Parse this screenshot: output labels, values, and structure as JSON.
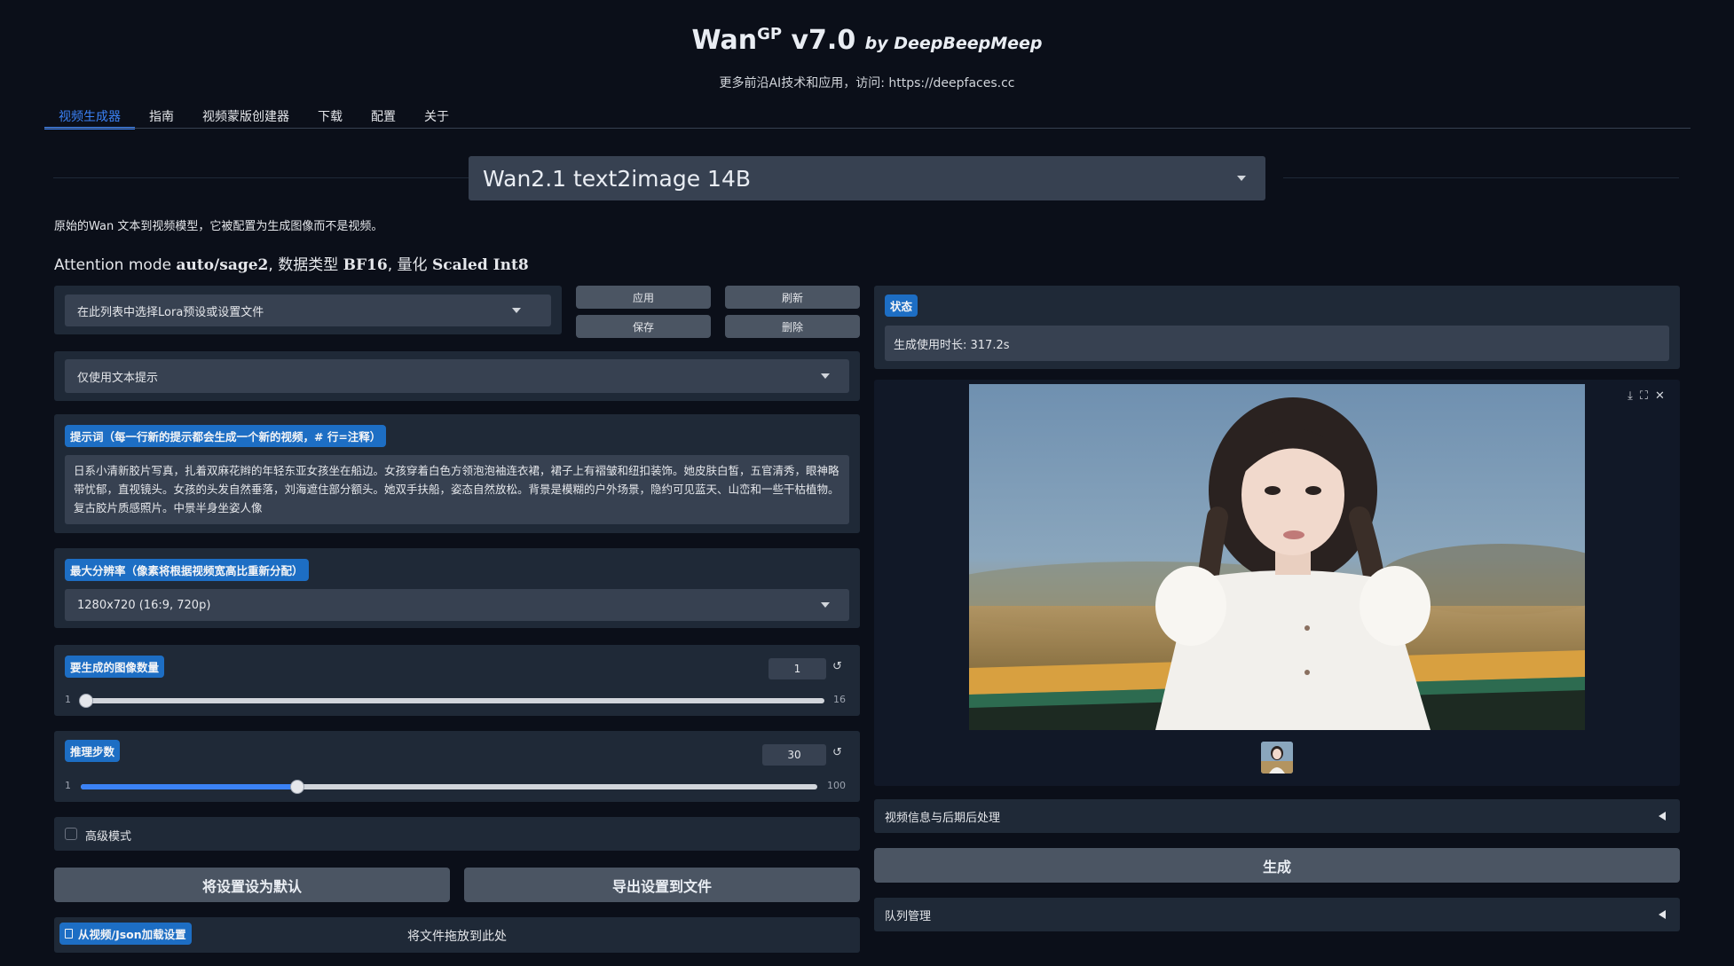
{
  "header": {
    "title_main": "Wan",
    "title_sup": "GP",
    "title_version": " v7.0 ",
    "title_by": "by DeepBeepMeep",
    "subtitle": "更多前沿AI技术和应用，访问: https://deepfaces.cc"
  },
  "tabs": [
    {
      "label": "视频生成器",
      "active": true
    },
    {
      "label": "指南"
    },
    {
      "label": "视频蒙版创建器"
    },
    {
      "label": "下载"
    },
    {
      "label": "配置"
    },
    {
      "label": "关于"
    }
  ],
  "model": {
    "selected": "Wan2.1 text2image 14B",
    "description": "原始的Wan 文本到视频模型，它被配置为生成图像而不是视频。",
    "attention_prefix": "Attention mode ",
    "attention_mode": "auto/sage2",
    "dtype_prefix": ", 数据类型 ",
    "dtype": "BF16",
    "quant_prefix": ", 量化 ",
    "quant": "Scaled Int8"
  },
  "lora": {
    "placeholder": "在此列表中选择Lora预设或设置文件",
    "apply": "应用",
    "refresh": "刷新",
    "save": "保存",
    "delete": "删除"
  },
  "prompt_mode": "仅使用文本提示",
  "prompt": {
    "label": "提示词（每一行新的提示都会生成一个新的视频，# 行=注释）",
    "text": "日系小清新胶片写真，扎着双麻花辫的年轻东亚女孩坐在船边。女孩穿着白色方领泡泡袖连衣裙，裙子上有褶皱和纽扣装饰。她皮肤白皙，五官清秀，眼神略带忧郁，直视镜头。女孩的头发自然垂落，刘海遮住部分额头。她双手扶船，姿态自然放松。背景是模糊的户外场景，隐约可见蓝天、山峦和一些干枯植物。复古胶片质感照片。中景半身坐姿人像"
  },
  "resolution": {
    "label": "最大分辨率（像素将根据视频宽高比重新分配）",
    "selected": "1280x720 (16:9, 720p)"
  },
  "num_images": {
    "label": "要生成的图像数量",
    "value": "1",
    "min": "1",
    "max": "16",
    "fraction": 0.0
  },
  "steps": {
    "label": "推理步数",
    "value": "30",
    "min": "1",
    "max": "100",
    "fraction": 0.293
  },
  "advanced_mode": "高级模式",
  "buttons": {
    "set_default": "将设置设为默认",
    "export": "导出设置到文件",
    "load_from": "从视频/Json加载设置",
    "drop_here": "将文件拖放到此处"
  },
  "status": {
    "label": "状态",
    "text": "生成使用时长: 317.2s"
  },
  "video_info": "视频信息与后期后处理",
  "generate": "生成",
  "queue": "队列管理",
  "colors": {
    "background": "#0b0f19",
    "panel": "#1f2937",
    "accent": "#3b82f6",
    "chip": "#1d6ec4"
  },
  "icons": [
    "download-icon",
    "fullscreen-icon",
    "close-icon",
    "reset-icon",
    "file-icon"
  ]
}
